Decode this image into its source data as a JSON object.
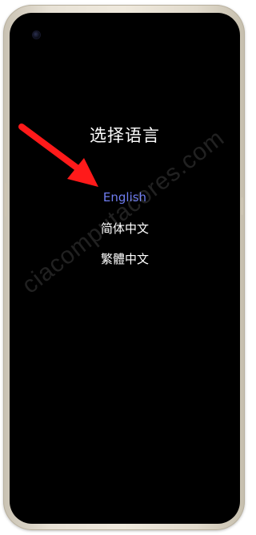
{
  "screen": {
    "title": "选择语言",
    "languages": [
      {
        "label": "English",
        "selected": true
      },
      {
        "label": "简体中文",
        "selected": false
      },
      {
        "label": "繁體中文",
        "selected": false
      }
    ],
    "selected_color": "#6f7df0"
  },
  "watermark": "ciacomputacores.com",
  "annotation": {
    "arrow_color": "#ff1a1a"
  }
}
